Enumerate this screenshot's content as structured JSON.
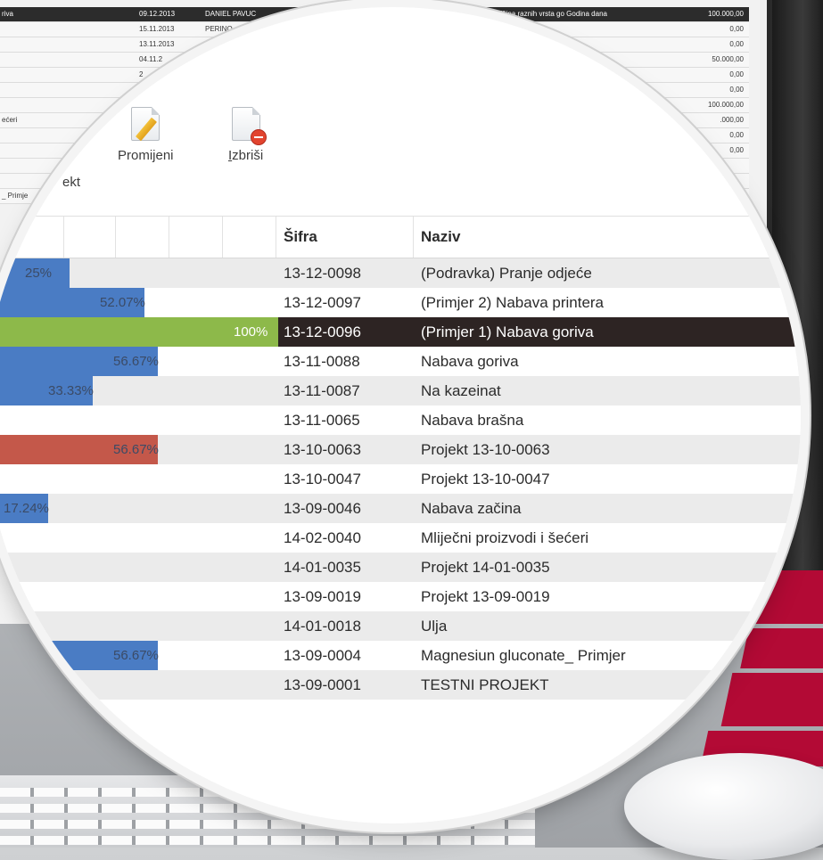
{
  "colors": {
    "bar_blue": "#4a7cc4",
    "bar_green": "#8db94a",
    "bar_red": "#c4584a",
    "selected_row": "#2d2423",
    "logo_red": "#b30a35"
  },
  "background_table": {
    "rows": [
      {
        "left": "riva",
        "date": "09.12.2013",
        "name": "DANIEL PAVUC",
        "desc": "ližina raznih vrsta go Godina dana",
        "amount": "100.000,00",
        "selected": true
      },
      {
        "left": "",
        "date": "15.11.2013",
        "name": "PERINO",
        "desc": "",
        "amount": "0,00"
      },
      {
        "left": "",
        "date": "13.11.2013",
        "name": "",
        "desc": "",
        "amount": "0,00"
      },
      {
        "left": "",
        "date": "04.11.2",
        "name": "",
        "desc": "",
        "amount": "50.000,00"
      },
      {
        "left": "",
        "date": "2",
        "name": "",
        "desc": "",
        "amount": "0,00"
      },
      {
        "left": "",
        "date": "",
        "name": "",
        "desc": "",
        "amount": "0,00"
      },
      {
        "left": "",
        "date": "",
        "name": "",
        "desc": "",
        "amount": "100.000,00"
      },
      {
        "left": "ećeri",
        "date": "",
        "name": "",
        "desc": "",
        "amount": ".000,00"
      },
      {
        "left": "",
        "date": "",
        "name": "",
        "desc": "",
        "amount": "0,00"
      },
      {
        "left": "",
        "date": "",
        "name": "",
        "desc": "",
        "amount": "0,00"
      },
      {
        "left": "",
        "date": "",
        "name": "",
        "desc": "",
        "amount": ""
      },
      {
        "left": "",
        "date": "",
        "name": "",
        "desc": "",
        "amount": ""
      },
      {
        "left": "_ Primje",
        "date": "",
        "name": "",
        "desc": "",
        "amount": ""
      }
    ]
  },
  "toolbar": {
    "partial_label": "ekt",
    "edit_label": "Promijeni",
    "edit_icon": "document-pencil-icon",
    "delete_label": "Izbriši",
    "delete_icon": "document-delete-icon"
  },
  "grid": {
    "columns": {
      "sifra": "Šifra",
      "naziv": "Naziv"
    },
    "rows": [
      {
        "progress_label": "25%",
        "progress_color": "blue",
        "sifra": "13-12-0098",
        "naziv": "(Podravka) Pranje odjeće"
      },
      {
        "progress_label": "52.07%",
        "progress_color": "blue",
        "sifra": "13-12-0097",
        "naziv": "(Primjer 2) Nabava printera"
      },
      {
        "progress_label": "100%",
        "progress_color": "green",
        "sifra": "13-12-0096",
        "naziv": "(Primjer 1) Nabava goriva",
        "selected": true
      },
      {
        "progress_label": "56.67%",
        "progress_color": "blue",
        "sifra": "13-11-0088",
        "naziv": "Nabava goriva"
      },
      {
        "progress_label": "33.33%",
        "progress_color": "blue",
        "sifra": "13-11-0087",
        "naziv": "Na kazeinat"
      },
      {
        "progress_label": "",
        "progress_color": "",
        "sifra": "13-11-0065",
        "naziv": "Nabava brašna"
      },
      {
        "progress_label": "56.67%",
        "progress_color": "red",
        "sifra": "13-10-0063",
        "naziv": "Projekt 13-10-0063"
      },
      {
        "progress_label": "",
        "progress_color": "",
        "sifra": "13-10-0047",
        "naziv": "Projekt 13-10-0047"
      },
      {
        "progress_label": "17.24%",
        "progress_color": "blue",
        "sifra": "13-09-0046",
        "naziv": "Nabava začina"
      },
      {
        "progress_label": "",
        "progress_color": "",
        "sifra": "14-02-0040",
        "naziv": "Mliječni proizvodi i šećeri"
      },
      {
        "progress_label": "",
        "progress_color": "",
        "sifra": "14-01-0035",
        "naziv": "Projekt 14-01-0035"
      },
      {
        "progress_label": "",
        "progress_color": "",
        "sifra": "13-09-0019",
        "naziv": "Projekt 13-09-0019"
      },
      {
        "progress_label": "",
        "progress_color": "",
        "sifra": "14-01-0018",
        "naziv": "Ulja"
      },
      {
        "progress_label": "56.67%",
        "progress_color": "blue",
        "sifra": "13-09-0004",
        "naziv": "Magnesiun gluconate_ Primjer"
      },
      {
        "progress_label": "",
        "progress_color": "",
        "sifra": "13-09-0001",
        "naziv": "TESTNI PROJEKT"
      }
    ]
  }
}
